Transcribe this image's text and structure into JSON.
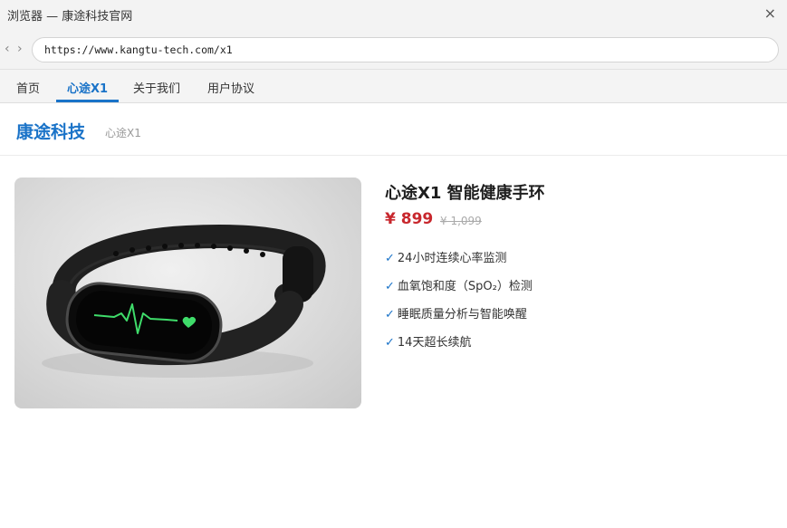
{
  "browser": {
    "window_title": "浏览器 — 康途科技官网",
    "close_glyph": "×",
    "back_glyph": "‹",
    "forward_glyph": "›",
    "url": "https://www.kangtu-tech.com/x1"
  },
  "site_nav": {
    "tabs": [
      {
        "label": "首页",
        "active": false
      },
      {
        "label": "心途X1",
        "active": true
      },
      {
        "label": "关于我们",
        "active": false
      },
      {
        "label": "用户协议",
        "active": false
      }
    ]
  },
  "header": {
    "brand": "康途科技",
    "breadcrumb": "心途X1"
  },
  "product": {
    "title": "心途X1 智能健康手环",
    "price": "¥ 899",
    "original_price": "¥ 1,099",
    "check_glyph": "✓",
    "features": [
      "24小时连续心率监测",
      "血氧饱和度（SpO₂）检测",
      "睡眠质量分析与智能唤醒",
      "14天超长续航"
    ],
    "image_alt": "smart fitness band with heart rate display"
  },
  "colors": {
    "accent": "#1a73c8",
    "price": "#c8272d",
    "screen_line": "#3fdc6a"
  }
}
